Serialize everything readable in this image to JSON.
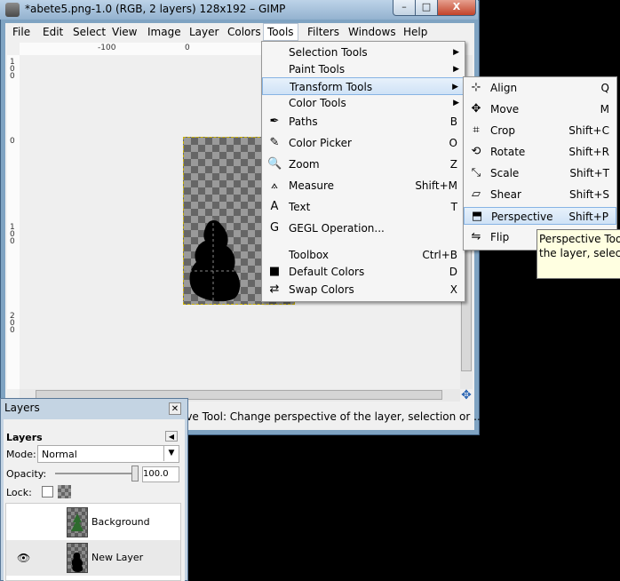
{
  "window": {
    "title": "*abete5.png-1.0 (RGB, 2 layers) 128x192 – GIMP",
    "controls": {
      "minimize": "–",
      "maximize": "□",
      "close": "X"
    }
  },
  "menubar": {
    "file": "File",
    "edit": "Edit",
    "select": "Select",
    "view": "View",
    "image": "Image",
    "layer": "Layer",
    "colors": "Colors",
    "tools": "Tools",
    "filters": "Filters",
    "windows": "Windows",
    "help": "Help"
  },
  "rulers": {
    "h_ticks": [
      "-100",
      "0"
    ],
    "v_ticks": [
      "1\n0\n0",
      "0",
      "1\n0\n0",
      "2\n0\n0"
    ]
  },
  "tools_menu": {
    "items": [
      {
        "label": "Selection Tools",
        "shortcut": "",
        "submenu": true,
        "icon": ""
      },
      {
        "label": "Paint Tools",
        "shortcut": "",
        "submenu": true,
        "icon": ""
      },
      {
        "label": "Transform Tools",
        "shortcut": "",
        "submenu": true,
        "icon": "",
        "highlighted": true
      },
      {
        "label": "Color Tools",
        "shortcut": "",
        "submenu": true,
        "icon": ""
      },
      {
        "label": "Paths",
        "shortcut": "B",
        "icon": "paths-icon"
      },
      {
        "label": "Color Picker",
        "shortcut": "O",
        "icon": "color-picker-icon"
      },
      {
        "label": "Zoom",
        "shortcut": "Z",
        "icon": "zoom-icon"
      },
      {
        "label": "Measure",
        "shortcut": "Shift+M",
        "icon": "measure-icon"
      },
      {
        "label": "Text",
        "shortcut": "T",
        "icon": "text-icon"
      },
      {
        "label": "GEGL Operation...",
        "shortcut": "",
        "icon": "gegl-icon"
      },
      {
        "label": "Toolbox",
        "shortcut": "Ctrl+B",
        "icon": ""
      },
      {
        "label": "Default Colors",
        "shortcut": "D",
        "icon": "default-colors-icon"
      },
      {
        "label": "Swap Colors",
        "shortcut": "X",
        "icon": "swap-colors-icon"
      }
    ]
  },
  "transform_menu": {
    "items": [
      {
        "label": "Align",
        "shortcut": "Q",
        "icon": "align-icon"
      },
      {
        "label": "Move",
        "shortcut": "M",
        "icon": "move-icon"
      },
      {
        "label": "Crop",
        "shortcut": "Shift+C",
        "icon": "crop-icon"
      },
      {
        "label": "Rotate",
        "shortcut": "Shift+R",
        "icon": "rotate-icon"
      },
      {
        "label": "Scale",
        "shortcut": "Shift+T",
        "icon": "scale-icon"
      },
      {
        "label": "Shear",
        "shortcut": "Shift+S",
        "icon": "shear-icon"
      },
      {
        "label": "Perspective",
        "shortcut": "Shift+P",
        "icon": "perspective-icon",
        "highlighted": true
      },
      {
        "label": "Flip",
        "shortcut": "",
        "icon": "flip-icon"
      }
    ]
  },
  "tooltip": {
    "line1": "Perspective Tool:",
    "line2": "the layer, selectio"
  },
  "status": {
    "text": "ive Tool: Change perspective of the layer, selection or ..."
  },
  "layers": {
    "window_title": "Layers",
    "tab_label": "Layers",
    "mode_label": "Mode:",
    "mode_value": "Normal",
    "opacity_label": "Opacity:",
    "opacity_value": "100.0",
    "lock_label": "Lock:",
    "list": [
      {
        "name": "Background",
        "visible": false
      },
      {
        "name": "New Layer",
        "visible": true
      }
    ]
  },
  "colors": {
    "highlight": "#cfe2f6",
    "tooltip_bg": "#ffffe1",
    "desktop": "#000000"
  }
}
